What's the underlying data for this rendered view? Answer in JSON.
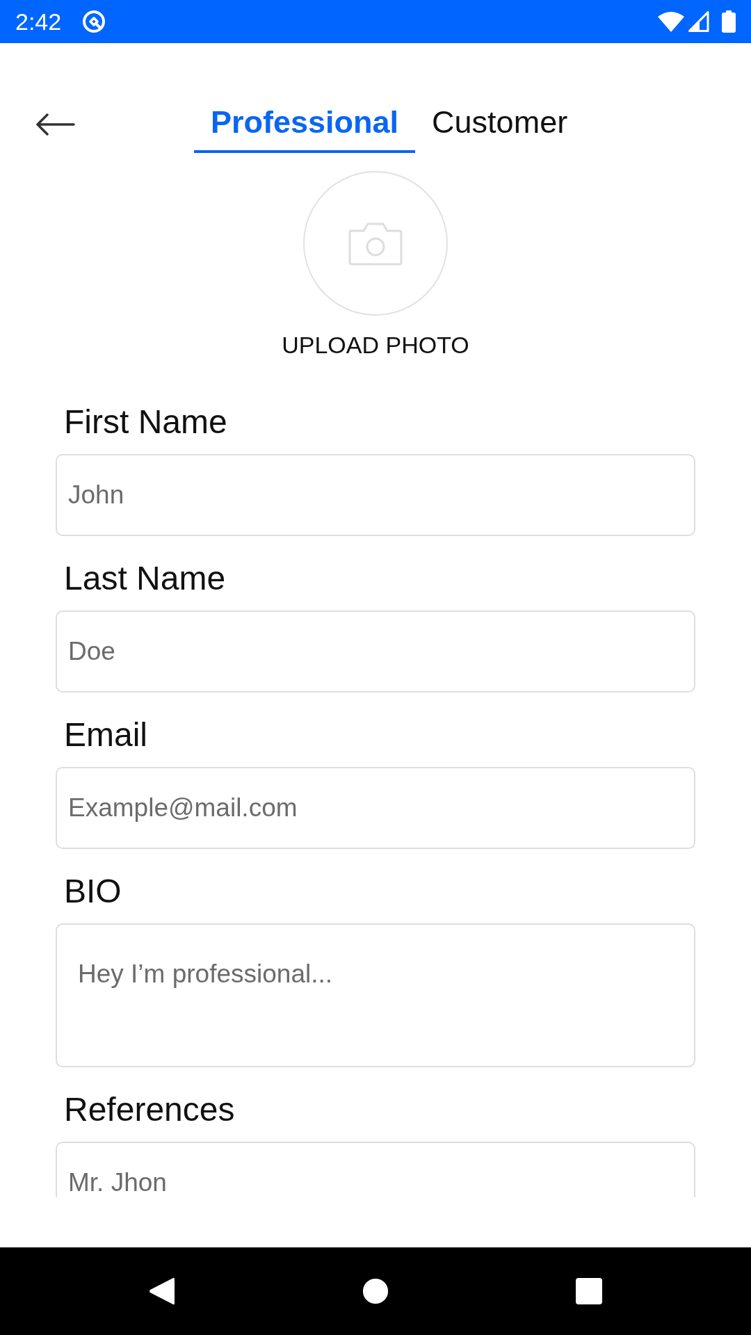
{
  "status_bar": {
    "time": "2:42"
  },
  "header": {
    "tabs": [
      {
        "label": "Professional",
        "selected": true
      },
      {
        "label": "Customer",
        "selected": false
      }
    ]
  },
  "photo": {
    "label": "UPLOAD PHOTO"
  },
  "form": {
    "fields": [
      {
        "label": "First Name",
        "placeholder": "John",
        "kind": "line"
      },
      {
        "label": "Last Name",
        "placeholder": "Doe",
        "kind": "line"
      },
      {
        "label": "Email",
        "placeholder": "Example@mail.com",
        "kind": "line"
      },
      {
        "label": "BIO",
        "placeholder": "Hey I’m professional...",
        "kind": "multiline"
      },
      {
        "label": "References",
        "placeholder": "Mr. Jhon",
        "kind": "line"
      }
    ]
  }
}
